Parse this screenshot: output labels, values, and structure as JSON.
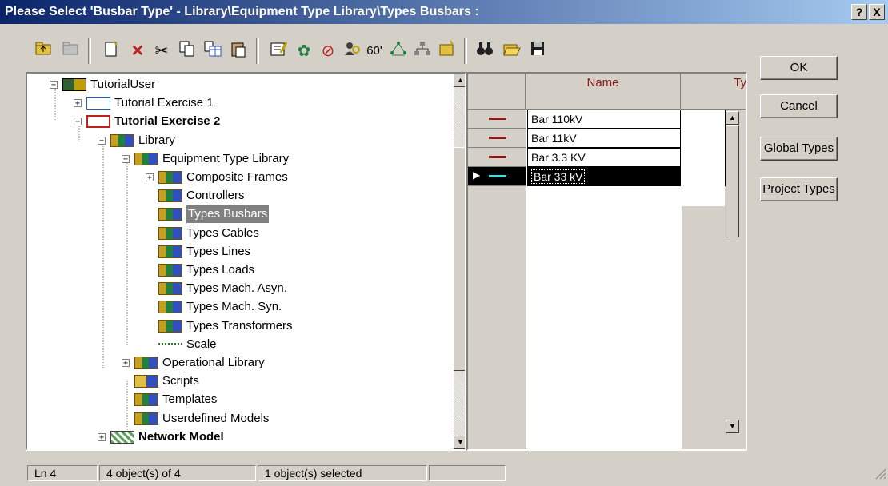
{
  "window": {
    "title": "Please Select 'Busbar Type' - Library\\Equipment Type Library\\Types Busbars :",
    "help_label": "?",
    "close_label": "X"
  },
  "toolbar": {
    "icons": [
      "folder-up-icon",
      "folder-icon",
      "new-object-icon",
      "delete-icon",
      "cut-icon",
      "copy-icon",
      "copy-table-icon",
      "paste-icon",
      "edit-object-icon",
      "settings-icon",
      "forbidden-icon",
      "user-search-icon",
      "glasses-icon",
      "network-icon",
      "hierarchy-icon",
      "new-folder-icon",
      "binoculars-icon",
      "open-folder-icon",
      "save-disk-icon"
    ]
  },
  "tree": {
    "items": [
      {
        "label": "TutorialUser",
        "expander": "−",
        "icon": "user-icon",
        "bold": false
      },
      {
        "label": "Tutorial Exercise 1",
        "expander": "+",
        "icon": "project-icon",
        "bold": false
      },
      {
        "label": "Tutorial Exercise 2",
        "expander": "−",
        "icon": "project-active-icon",
        "bold": true
      },
      {
        "label": "Library",
        "expander": "−",
        "icon": "library-icon",
        "bold": false
      },
      {
        "label": "Equipment Type Library",
        "expander": "−",
        "icon": "library-icon",
        "bold": false
      },
      {
        "label": "Composite Frames",
        "expander": "+",
        "icon": "library-icon",
        "bold": false
      },
      {
        "label": "Controllers",
        "expander": "",
        "icon": "library-icon",
        "bold": false
      },
      {
        "label": "Types Busbars",
        "expander": "",
        "icon": "library-icon",
        "bold": false,
        "selected": true
      },
      {
        "label": "Types Cables",
        "expander": "",
        "icon": "library-icon",
        "bold": false
      },
      {
        "label": "Types Lines",
        "expander": "",
        "icon": "library-icon",
        "bold": false
      },
      {
        "label": "Types Loads",
        "expander": "",
        "icon": "library-icon",
        "bold": false
      },
      {
        "label": "Types Mach. Asyn.",
        "expander": "",
        "icon": "library-icon",
        "bold": false
      },
      {
        "label": "Types Mach. Syn.",
        "expander": "",
        "icon": "library-icon",
        "bold": false
      },
      {
        "label": "Types Transformers",
        "expander": "",
        "icon": "library-icon",
        "bold": false
      },
      {
        "label": "Scale",
        "expander": "",
        "icon": "scale-icon",
        "bold": false
      },
      {
        "label": "Operational Library",
        "expander": "+",
        "icon": "library-icon",
        "bold": false
      },
      {
        "label": "Scripts",
        "expander": "",
        "icon": "scripts-icon",
        "bold": false
      },
      {
        "label": "Templates",
        "expander": "",
        "icon": "library-icon",
        "bold": false
      },
      {
        "label": "Userdefined Models",
        "expander": "",
        "icon": "library-icon",
        "bold": false
      },
      {
        "label": "Network Model",
        "expander": "+",
        "icon": "network-model-icon",
        "bold": true
      }
    ]
  },
  "grid": {
    "columns": [
      "Name",
      "Ty"
    ],
    "rows": [
      {
        "name": "Bar 110kV",
        "selected": false
      },
      {
        "name": "Bar 11kV",
        "selected": false
      },
      {
        "name": "Bar 3.3 KV",
        "selected": false
      },
      {
        "name": "Bar 33 kV",
        "selected": true
      }
    ],
    "row_marker": "▶"
  },
  "buttons": {
    "ok": "OK",
    "cancel": "Cancel",
    "global_types": "Global Types",
    "project_types": "Project Types"
  },
  "status": {
    "line": "Ln 4",
    "objects": "4 object(s) of 4",
    "selected": "1 object(s) selected",
    "extra": ""
  },
  "colors": {
    "title_start": "#0a246a",
    "title_end": "#a6caf0",
    "face": "#d4d0c8",
    "bus_red": "#8b1a1a",
    "bus_selected": "#40e0e0"
  }
}
